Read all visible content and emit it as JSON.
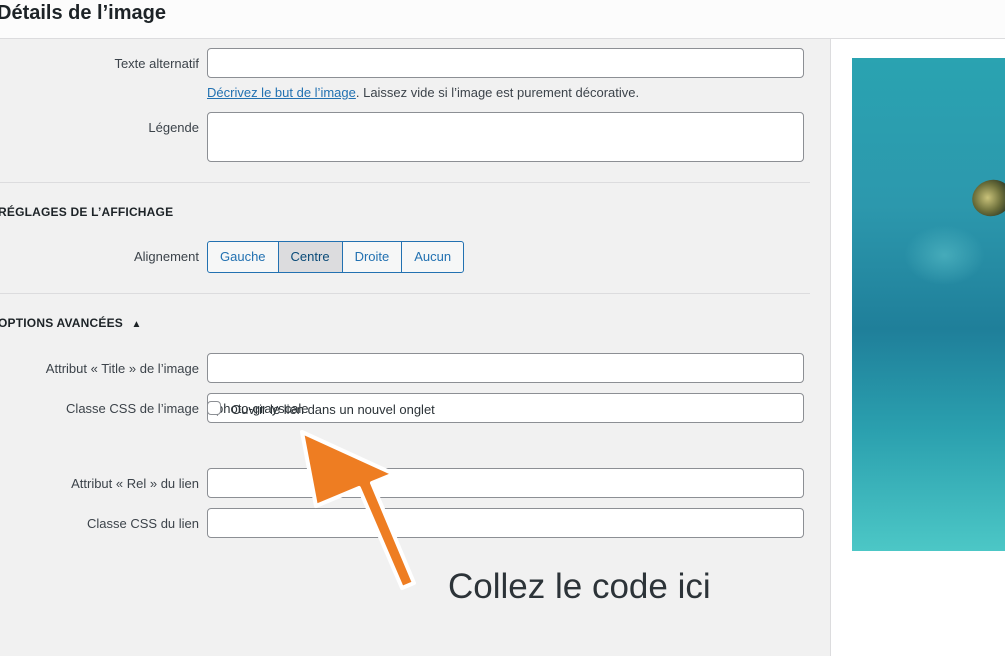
{
  "header": {
    "title": "Détails de l’image"
  },
  "form": {
    "alt_text": {
      "label": "Texte alternatif",
      "value": ""
    },
    "help": {
      "link": "Décrivez le but de l’image",
      "rest": ". Laissez vide si l’image est purement décorative."
    },
    "caption": {
      "label": "Légende",
      "value": ""
    }
  },
  "display": {
    "section_title": "RÉGLAGES DE L’AFFICHAGE",
    "alignment_label": "Alignement",
    "alignment_options": [
      "Gauche",
      "Centre",
      "Droite",
      "Aucun"
    ],
    "alignment_selected": "Centre"
  },
  "advanced": {
    "section_title": "OPTIONS AVANCÉES",
    "toggle_glyph": "▲",
    "title_attr": {
      "label": "Attribut « Title » de l’image",
      "value": ""
    },
    "image_css": {
      "label": "Classe CSS de l’image",
      "value": "photo-grayscale"
    },
    "open_new_tab": {
      "label": "Ouvrir le lien dans un nouvel onglet",
      "checked": false
    },
    "rel_attr": {
      "label": "Attribut « Rel » du lien",
      "value": ""
    },
    "link_css": {
      "label": "Classe CSS du lien",
      "value": ""
    }
  },
  "annotation": {
    "text": "Collez le code ici",
    "arrow_color": "#ee7d22"
  }
}
